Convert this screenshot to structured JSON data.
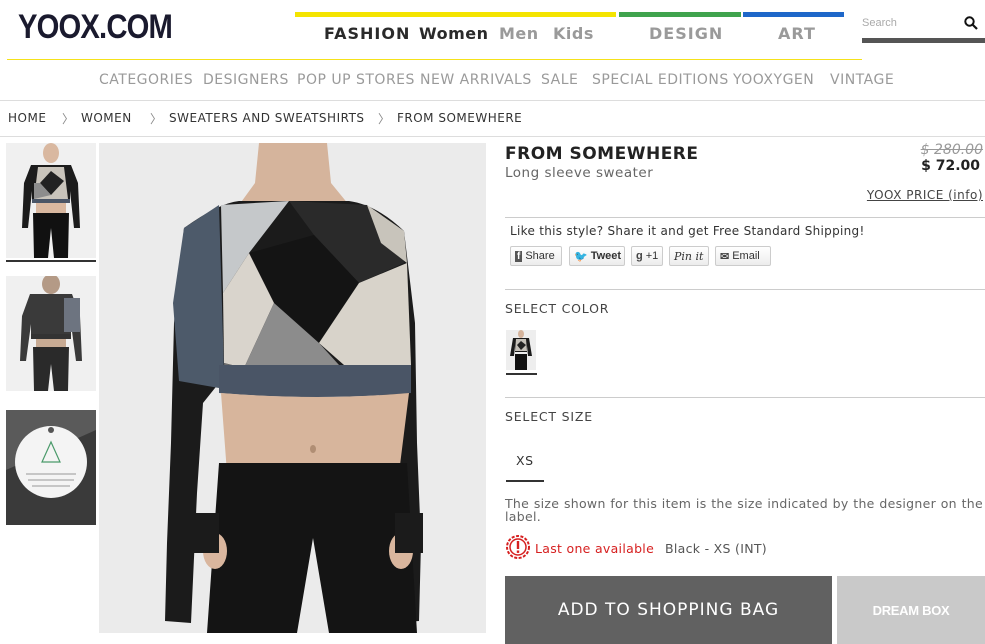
{
  "header": {
    "logo": "YOOX.COM",
    "nav": {
      "fashion": "FASHION",
      "women": "Women",
      "men": "Men",
      "kids": "Kids",
      "design": "DESIGN",
      "art": "ART"
    },
    "search_placeholder": "Search",
    "colors": {
      "fashion_bar": "#f4e400",
      "design_bar": "#3fa34d",
      "art_bar": "#1e67c9"
    }
  },
  "category_nav": [
    "CATEGORIES",
    "DESIGNERS",
    "POP UP STORES",
    "NEW ARRIVALS",
    "SALE",
    "SPECIAL EDITIONS",
    "YOOXYGEN",
    "VINTAGE"
  ],
  "breadcrumb": [
    "HOME",
    "WOMEN",
    "SWEATERS AND SWEATSHIRTS",
    "FROM SOMEWHERE"
  ],
  "product": {
    "brand": "FROM SOMEWHERE",
    "subtitle": "Long sleeve sweater",
    "old_price": "$ 280.00",
    "new_price": "$ 72.00",
    "yoox_price_link": "YOOX PRICE (info)",
    "share_text": "Like this style? Share it and get Free Standard Shipping!",
    "share_buttons": {
      "share": "Share",
      "tweet": "Tweet",
      "plus": "+1",
      "pinit": "Pin it",
      "email": "Email"
    },
    "select_color_label": "SELECT COLOR",
    "select_size_label": "SELECT SIZE",
    "size": "XS",
    "size_note": "The size shown for this item is the size indicated by the designer on the label.",
    "stock_warning": "Last one available",
    "variant": "Black - XS (INT)",
    "add_to_bag": "ADD TO SHOPPING BAG",
    "dream_box": "DREAM BOX"
  }
}
